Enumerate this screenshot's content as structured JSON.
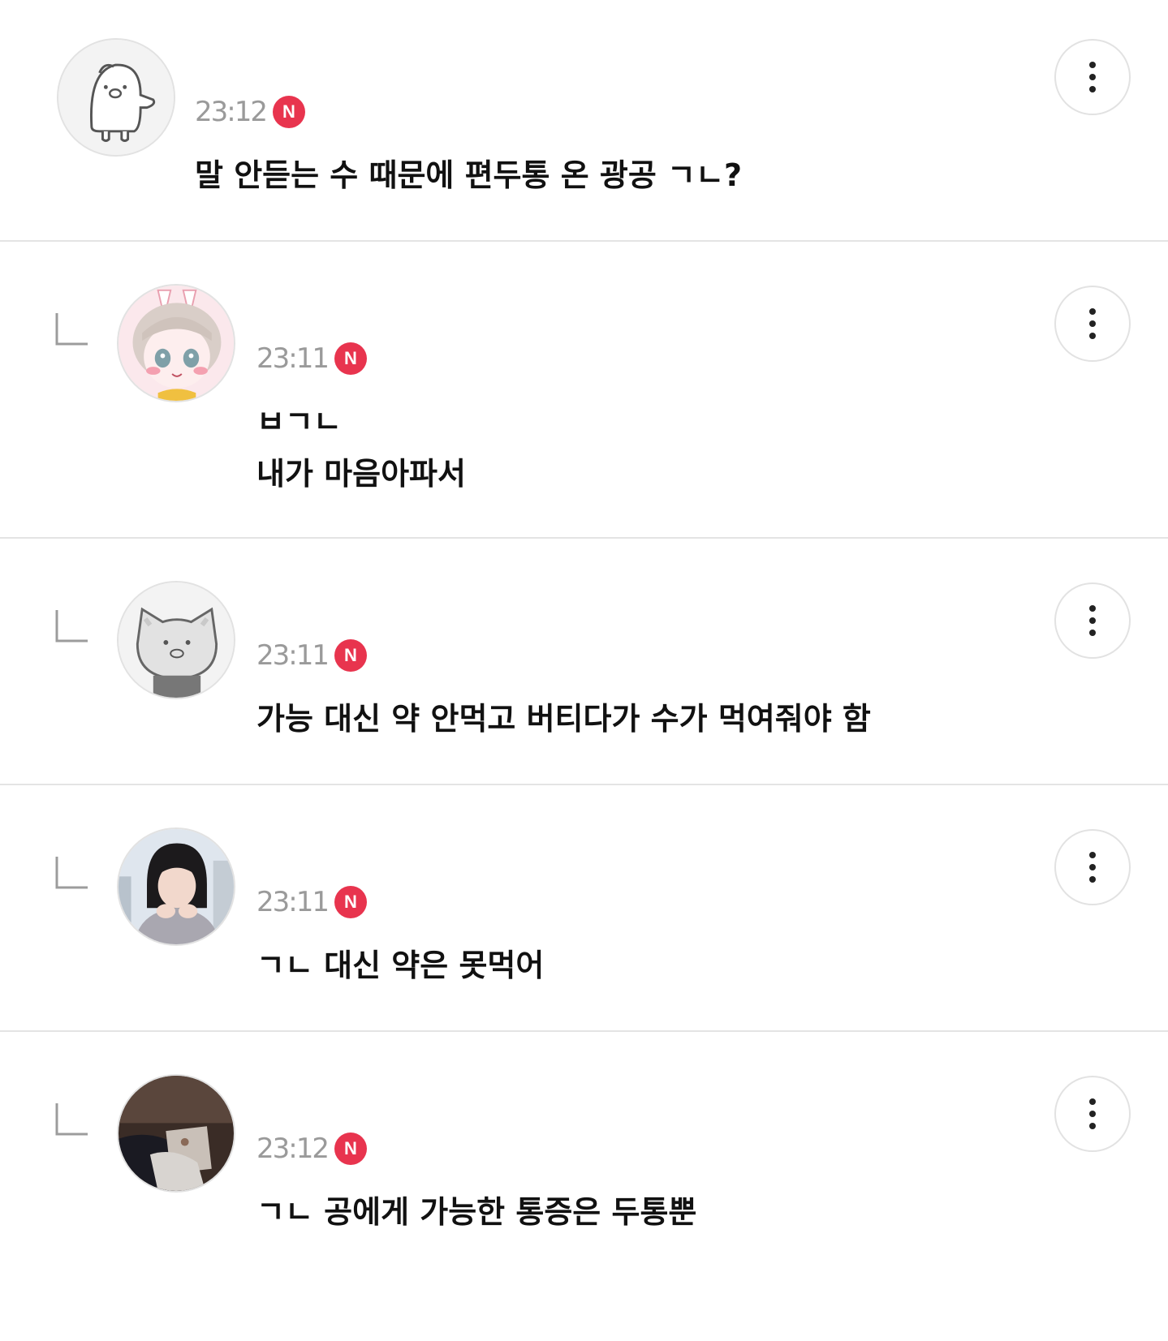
{
  "comments": [
    {
      "time": "23:12",
      "badge": "N",
      "avatar": "penguin-avatar",
      "lines": [
        "말 안듣는 수 때문에 편두통 온 광공 ㄱㄴ?"
      ],
      "reply": false
    },
    {
      "time": "23:11",
      "badge": "N",
      "avatar": "bunny-girl-avatar",
      "lines": [
        "ㅂㄱㄴ",
        "내가 마음아파서"
      ],
      "reply": true
    },
    {
      "time": "23:11",
      "badge": "N",
      "avatar": "cat-avatar",
      "lines": [
        "가능 대신 약 안먹고 버티다가 수가 먹여줘야 함"
      ],
      "reply": true
    },
    {
      "time": "23:11",
      "badge": "N",
      "avatar": "woman-photo-avatar",
      "lines": [
        "ㄱㄴ 대신 약은 못먹어"
      ],
      "reply": true
    },
    {
      "time": "23:12",
      "badge": "N",
      "avatar": "dark-photo-avatar",
      "lines": [
        "ㄱㄴ 공에게 가능한 통증은 두통뿐"
      ],
      "reply": true
    }
  ],
  "icons": {
    "reply": "reply-arrow-icon",
    "more": "more-vertical-icon"
  },
  "colors": {
    "badge": "#e8344e",
    "time": "#9a9a9a",
    "divider": "#e4e4e4"
  }
}
